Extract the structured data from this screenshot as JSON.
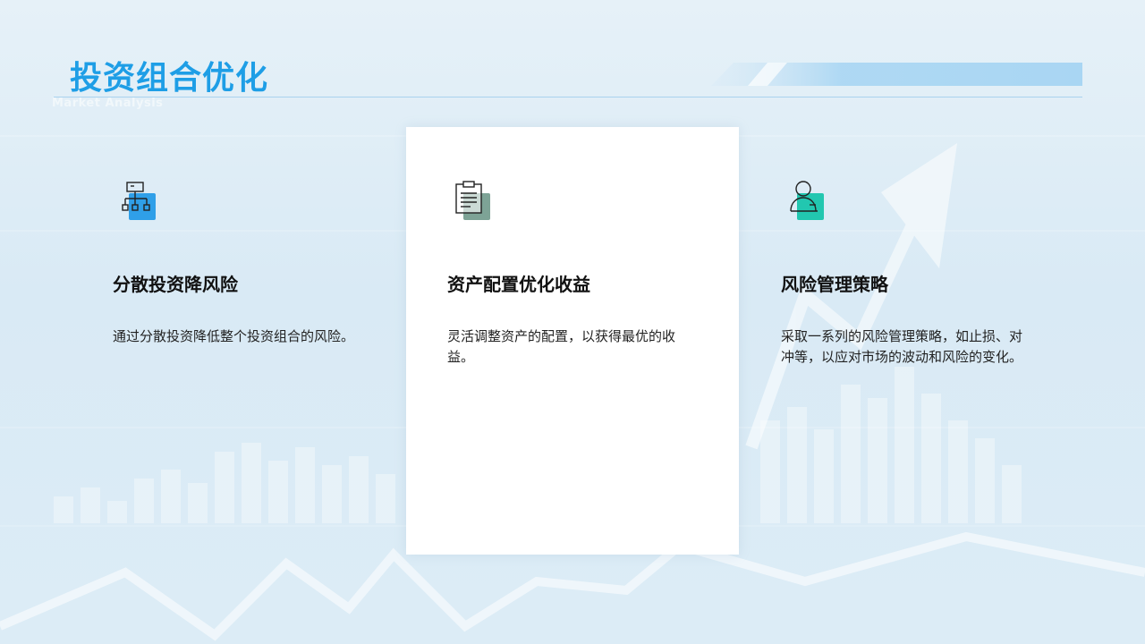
{
  "page": {
    "title": "投资组合优化",
    "subtitle_ghost": "Market Analysis"
  },
  "colors": {
    "title": "#1e9ee6",
    "accent_blue": "#2f9fe8",
    "accent_gray": "#7da396",
    "accent_teal": "#22c7b0"
  },
  "cards": [
    {
      "icon": "hierarchy-icon",
      "accent": "#2f9fe8",
      "title": "分散投资降风险",
      "desc": "通过分散投资降低整个投资组合的风险。",
      "highlighted": false
    },
    {
      "icon": "clipboard-icon",
      "accent": "#7da396",
      "title": "资产配置优化收益",
      "desc": "灵活调整资产的配置，以获得最优的收益。",
      "highlighted": true
    },
    {
      "icon": "user-icon",
      "accent": "#22c7b0",
      "title": "风险管理策略",
      "desc": "采取一系列的风险管理策略，如止损、对冲等，以应对市场的波动和风险的变化。",
      "highlighted": false
    }
  ]
}
